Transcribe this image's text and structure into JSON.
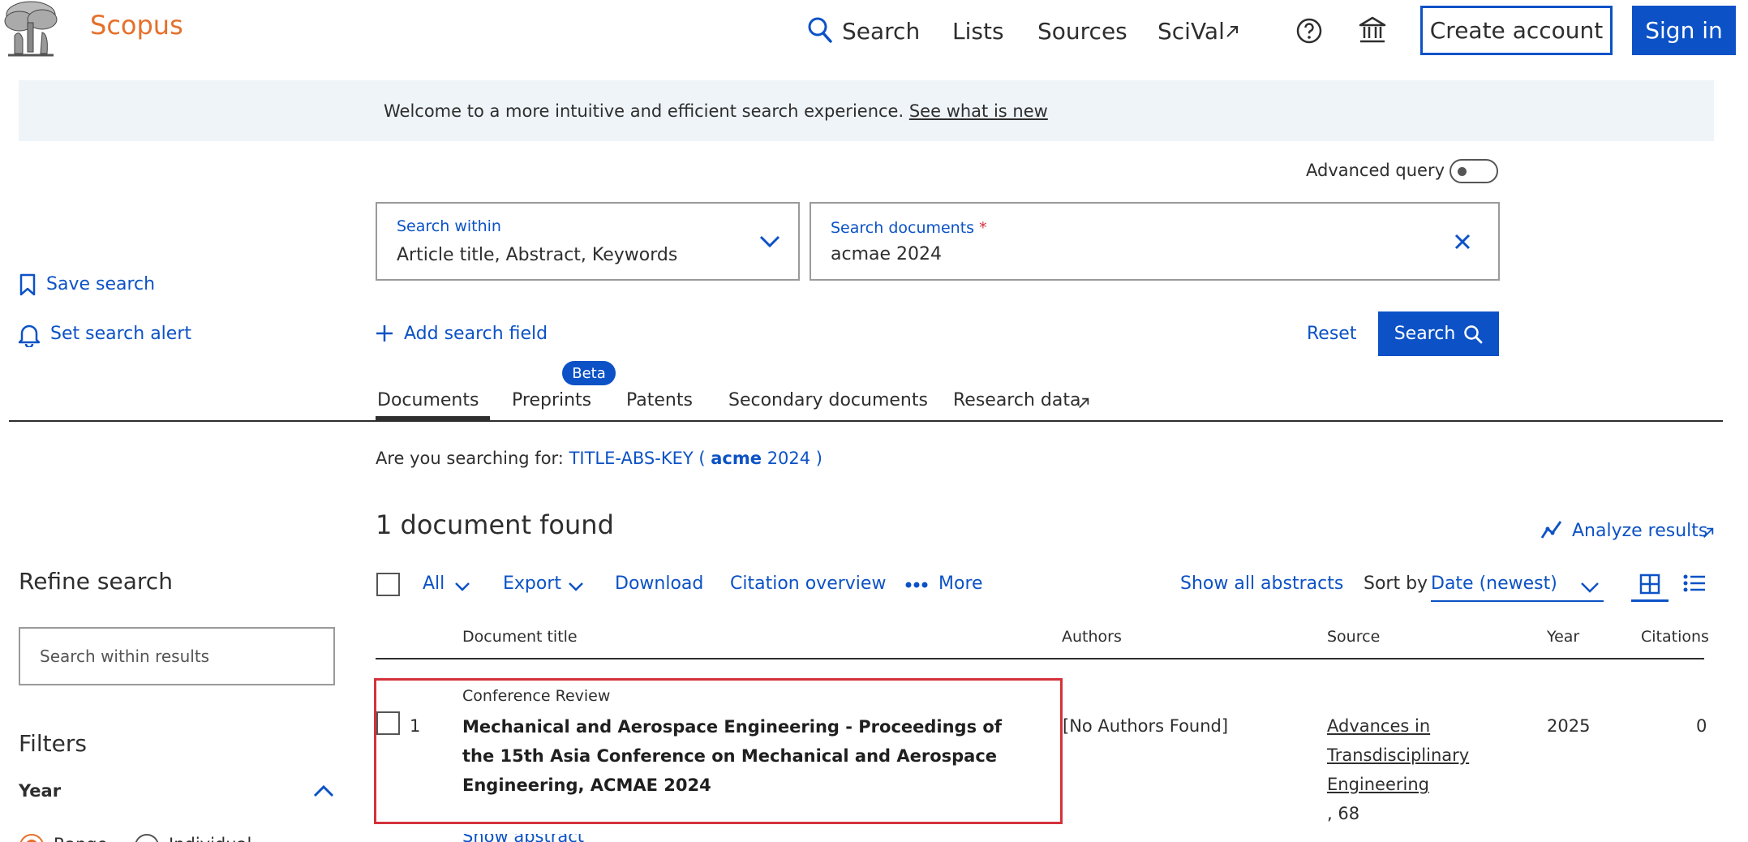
{
  "header": {
    "brand": "Scopus",
    "nav": {
      "search": "Search",
      "lists": "Lists",
      "sources": "Sources",
      "scival": "SciVal"
    },
    "create_account": "Create account",
    "sign_in": "Sign in"
  },
  "banner": {
    "text": "Welcome to a more intuitive and efficient search experience.",
    "link": "See what is new"
  },
  "search": {
    "advanced_query_label": "Advanced query",
    "within_label": "Search within",
    "within_value": "Article title, Abstract, Keywords",
    "documents_label": "Search documents",
    "required_mark": "*",
    "documents_value": "acmae 2024",
    "add_field": "Add search field",
    "reset": "Reset",
    "search_button": "Search"
  },
  "sidebar": {
    "save_search": "Save search",
    "set_alert": "Set search alert"
  },
  "tabs": {
    "documents": "Documents",
    "preprints": "Preprints",
    "beta": "Beta",
    "patents": "Patents",
    "secondary": "Secondary documents",
    "research_data": "Research data"
  },
  "suggestion": {
    "prefix": "Are you searching for:",
    "pre": "TITLE-ABS-KEY (",
    "term": "acme",
    "post": "2024 )"
  },
  "results": {
    "count_text": "1 document found",
    "analyze": "Analyze results",
    "toolbar": {
      "all": "All",
      "export": "Export",
      "download": "Download",
      "citation_overview": "Citation overview",
      "more": "More",
      "show_all_abstracts": "Show all abstracts",
      "sort_by_label": "Sort by",
      "sort_value": "Date (newest)"
    },
    "columns": {
      "title": "Document title",
      "authors": "Authors",
      "source": "Source",
      "year": "Year",
      "citations": "Citations"
    },
    "rows": [
      {
        "index": "1",
        "type": "Conference Review",
        "title": "Mechanical and Aerospace Engineering - Proceedings of the 15th Asia Conference on Mechanical and Aerospace Engineering, ACMAE 2024",
        "authors": "[No Authors Found]",
        "source": "Advances in Transdisciplinary Engineering",
        "source_suffix": ", 68",
        "year": "2025",
        "citations": "0",
        "show_abstract": "Show abstract"
      }
    ]
  },
  "refine": {
    "title": "Refine search",
    "input_placeholder": "Search within results",
    "filters": "Filters",
    "year_label": "Year",
    "range": "Range",
    "individual": "Individual"
  },
  "colors": {
    "brand": "#e5702b",
    "primary": "#0c52c6",
    "highlight_box": "#d4323b",
    "banner_bg": "#eff4f9"
  }
}
